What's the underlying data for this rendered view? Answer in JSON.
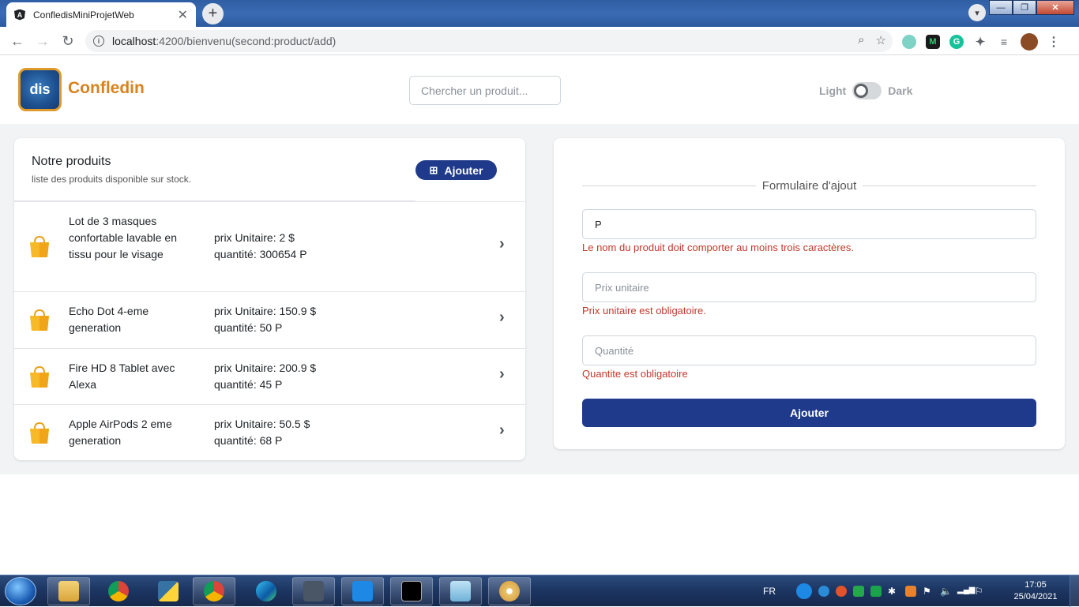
{
  "browser": {
    "tab_title": "ConfledisMiniProjetWeb",
    "tab_close": "✕",
    "new_tab": "+",
    "url_host": "localhost",
    "url_path": ":4200/bienvenu(second:product/add)",
    "win_minimize": "—",
    "win_maximize": "❐",
    "win_close": "✕"
  },
  "header": {
    "brand": "Confledin",
    "logo_text": "dis",
    "search_placeholder": "Chercher un produit...",
    "theme_light": "Light",
    "theme_dark": "Dark"
  },
  "products_panel": {
    "title": "Notre produits",
    "subtitle": "liste des produits disponible sur stock.",
    "add_button": "Ajouter",
    "items": [
      {
        "name": "Lot de 3 masques confortable lavable en tissu pour le visage",
        "price": "prix Unitaire: 2 $",
        "qty": "quantité: 300654 P"
      },
      {
        "name": "Echo Dot 4-eme generation",
        "price": "prix Unitaire: 150.9 $",
        "qty": "quantité: 50 P"
      },
      {
        "name": "Fire HD 8 Tablet avec Alexa",
        "price": "prix Unitaire: 200.9 $",
        "qty": "quantité: 45 P"
      },
      {
        "name": "Apple AirPods 2 eme generation",
        "price": "prix Unitaire: 50.5 $",
        "qty": "quantité: 68 P"
      }
    ]
  },
  "form": {
    "legend": "Formulaire d'ajout",
    "name_value": "P",
    "name_error": "Le nom du produit doit comporter au moins trois caractères.",
    "price_placeholder": "Prix unitaire",
    "price_error": "Prix unitaire est obligatoire.",
    "qty_placeholder": "Quantité",
    "qty_error": "Quantite est obligatoire",
    "submit": "Ajouter"
  },
  "taskbar": {
    "lang": "FR",
    "time": "17:05",
    "date": "25/04/2021"
  },
  "colors": {
    "brand_orange": "#d9821e",
    "primary_blue": "#1f3a8a",
    "error_red": "#c0392b"
  }
}
